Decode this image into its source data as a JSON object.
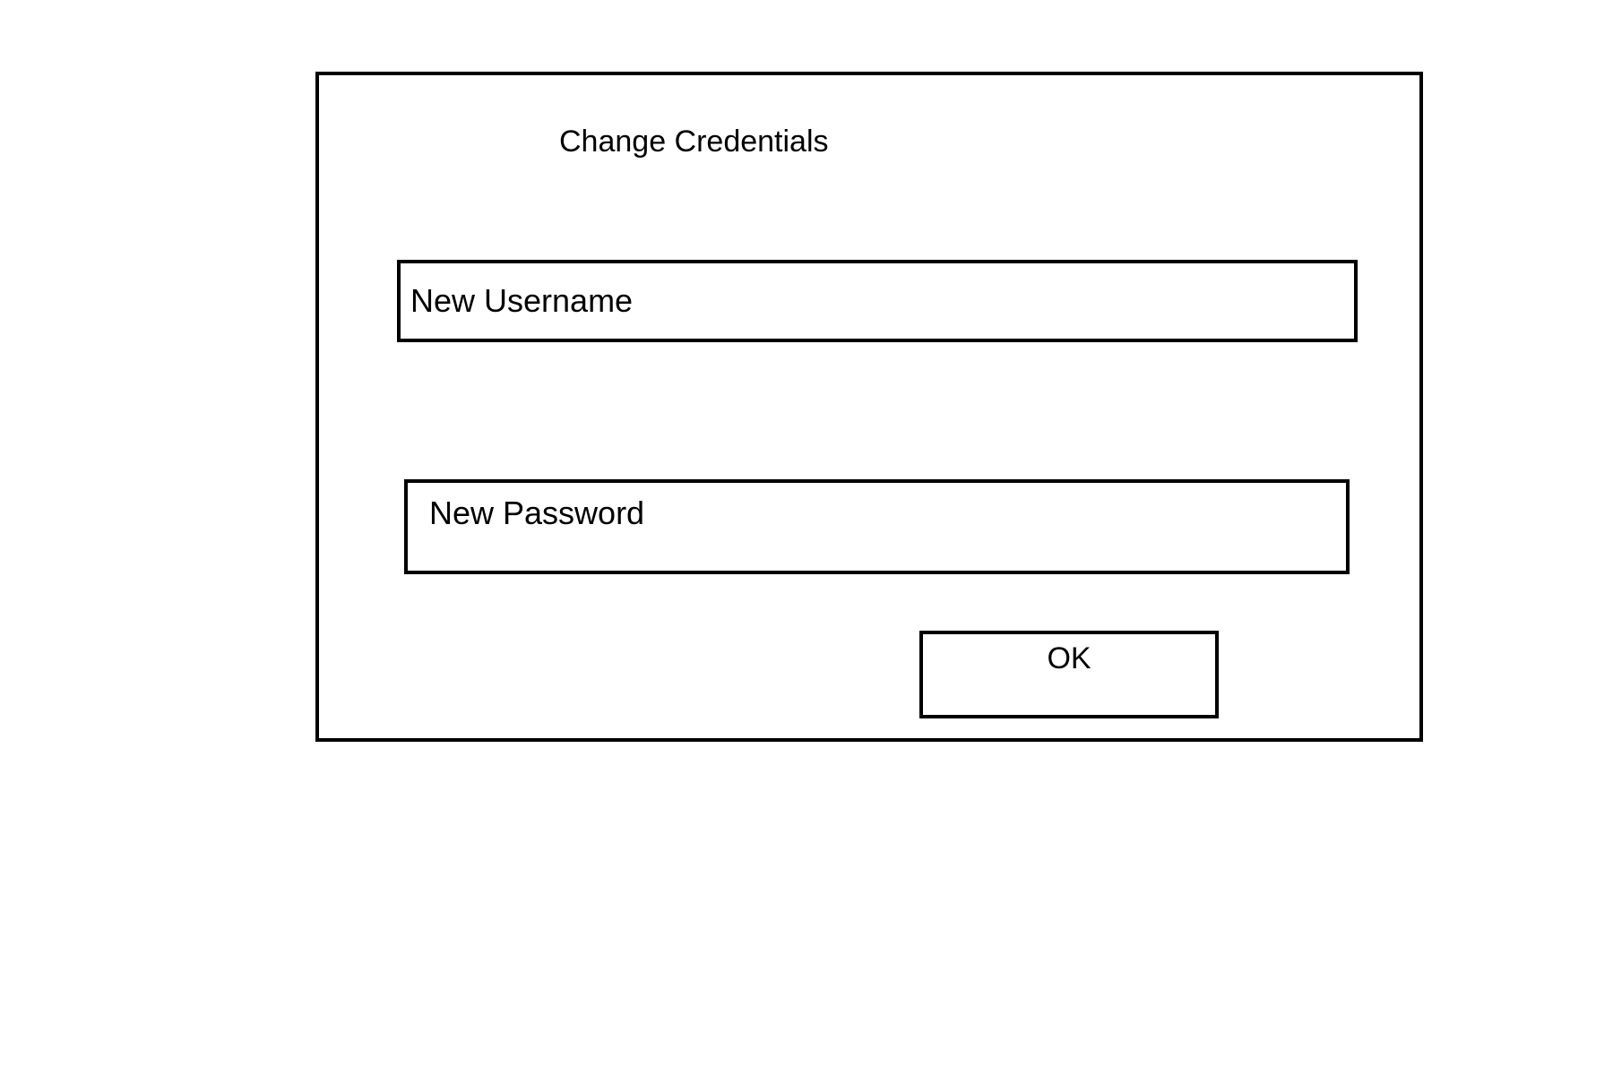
{
  "dialog": {
    "title": "Change Credentials",
    "username_field": {
      "placeholder": "New Username",
      "value": ""
    },
    "password_field": {
      "placeholder": "New Password",
      "value": ""
    },
    "ok_label": "OK"
  }
}
